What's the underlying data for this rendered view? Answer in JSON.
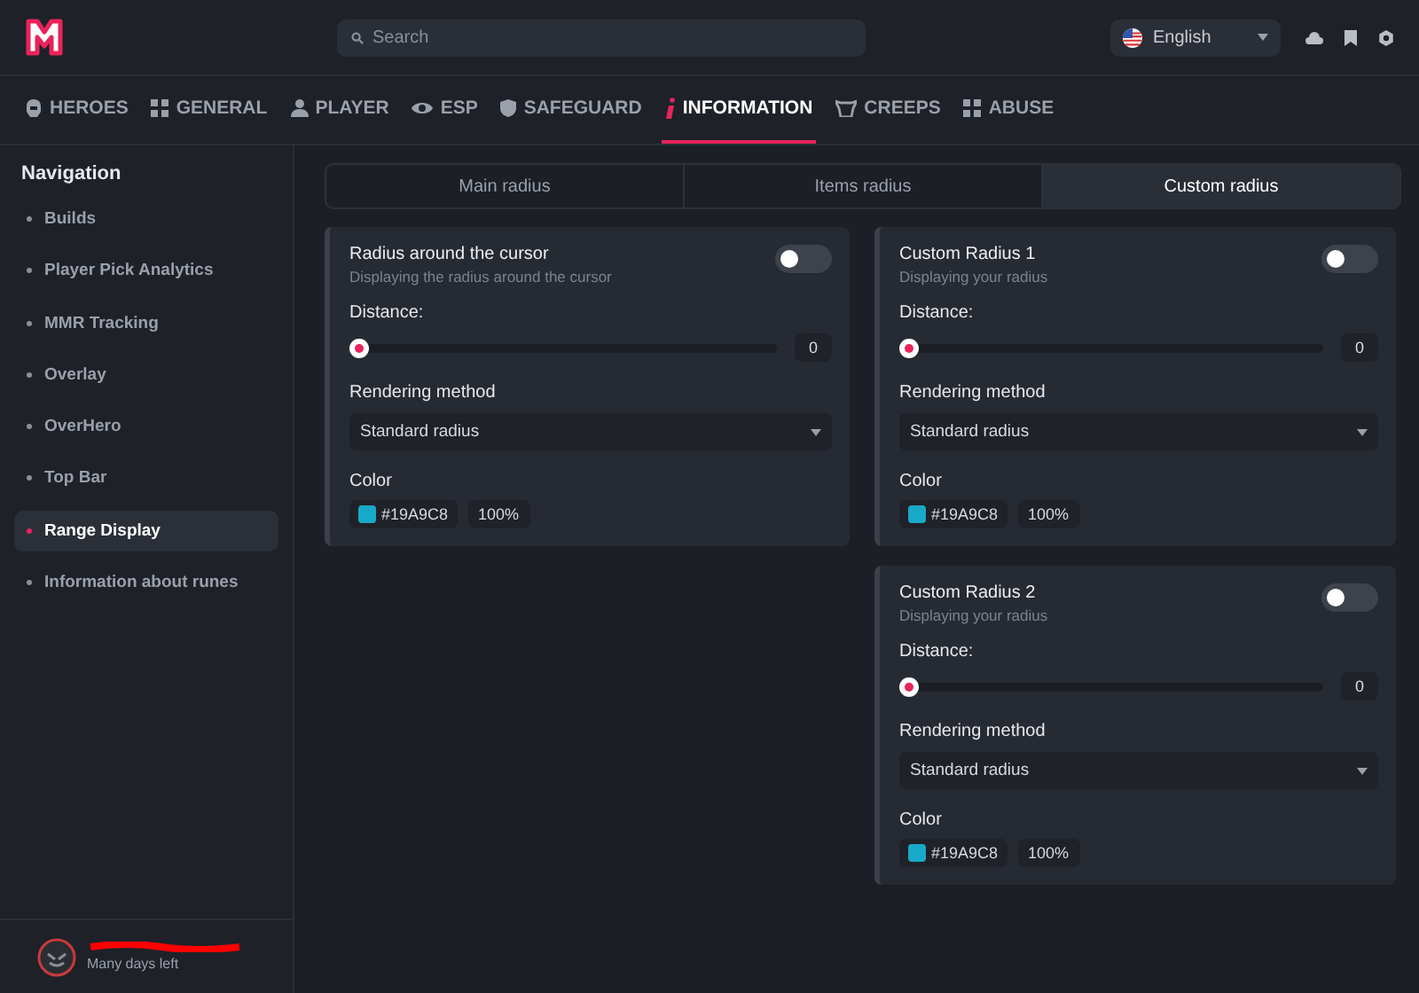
{
  "header": {
    "search": {
      "placeholder": "Search"
    },
    "language": {
      "value": "English"
    }
  },
  "tabs": [
    {
      "label": "HEROES",
      "kind": "helmet",
      "selected": false
    },
    {
      "label": "GENERAL",
      "kind": "grid",
      "selected": false
    },
    {
      "label": "PLAYER",
      "kind": "person",
      "selected": false
    },
    {
      "label": "ESP",
      "kind": "eye",
      "selected": false
    },
    {
      "label": "SAFEGUARD",
      "kind": "shield",
      "selected": false
    },
    {
      "label": "INFORMATION",
      "kind": "info",
      "selected": true
    },
    {
      "label": "CREEPS",
      "kind": "creep",
      "selected": false
    },
    {
      "label": "ABUSE",
      "kind": "grid",
      "selected": false
    }
  ],
  "sidebar": {
    "title": "Navigation",
    "items": [
      {
        "label": "Builds",
        "selected": false
      },
      {
        "label": "Player Pick Analytics",
        "selected": false
      },
      {
        "label": "MMR Tracking",
        "selected": false
      },
      {
        "label": "Overlay",
        "selected": false
      },
      {
        "label": "OverHero",
        "selected": false
      },
      {
        "label": "Top Bar",
        "selected": false
      },
      {
        "label": "Range Display",
        "selected": true
      },
      {
        "label": "Information about runes",
        "selected": false
      }
    ],
    "user": {
      "status": "Many days left"
    }
  },
  "subtabs": [
    {
      "label": "Main radius",
      "selected": false
    },
    {
      "label": "Items radius",
      "selected": false
    },
    {
      "label": "Custom radius",
      "selected": true
    }
  ],
  "columns": [
    [
      {
        "title": "Radius around the cursor",
        "subtitle": "Displaying the radius around the cursor",
        "on": false,
        "distance_label": "Distance:",
        "level": 0,
        "reading": "0",
        "method_label": "Rendering method",
        "method": "Standard radius",
        "color_label": "Color",
        "hex": "#19A9C8",
        "color": "#19a9c8",
        "opacity": "100%"
      }
    ],
    [
      {
        "title": "Custom Radius 1",
        "subtitle": "Displaying your radius",
        "on": false,
        "distance_label": "Distance:",
        "level": 0,
        "reading": "0",
        "method_label": "Rendering method",
        "method": "Standard radius",
        "color_label": "Color",
        "hex": "#19A9C8",
        "color": "#19a9c8",
        "opacity": "100%"
      },
      {
        "title": "Custom Radius 2",
        "subtitle": "Displaying your radius",
        "on": false,
        "distance_label": "Distance:",
        "level": 0,
        "reading": "0",
        "method_label": "Rendering method",
        "method": "Standard radius",
        "color_label": "Color",
        "hex": "#19A9C8",
        "color": "#19a9c8",
        "opacity": "100%"
      }
    ]
  ]
}
